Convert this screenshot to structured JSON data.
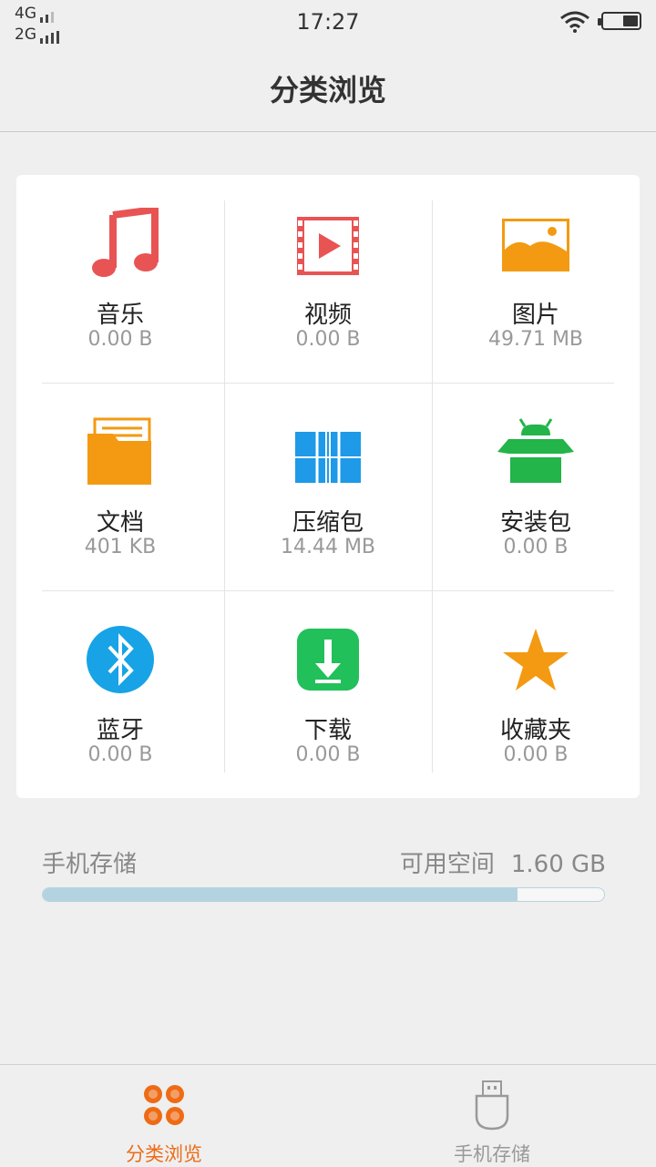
{
  "status_bar": {
    "network1": "4G",
    "network2": "2G",
    "time": "17:27"
  },
  "header": {
    "title": "分类浏览"
  },
  "categories": [
    {
      "name": "音乐",
      "size": "0.00 B",
      "icon": "music-note-icon",
      "color": "#e85454"
    },
    {
      "name": "视频",
      "size": "0.00 B",
      "icon": "film-play-icon",
      "color": "#e85454"
    },
    {
      "name": "图片",
      "size": "49.71 MB",
      "icon": "image-icon",
      "color": "#f39a12"
    },
    {
      "name": "文档",
      "size": "401 KB",
      "icon": "document-folder-icon",
      "color": "#f39a12"
    },
    {
      "name": "压缩包",
      "size": "14.44 MB",
      "icon": "archive-icon",
      "color": "#1e9ae8"
    },
    {
      "name": "安装包",
      "size": "0.00 B",
      "icon": "android-package-icon",
      "color": "#23b44a"
    },
    {
      "name": "蓝牙",
      "size": "0.00 B",
      "icon": "bluetooth-icon",
      "color": "#17a3e6"
    },
    {
      "name": "下载",
      "size": "0.00 B",
      "icon": "download-icon",
      "color": "#22c05a"
    },
    {
      "name": "收藏夹",
      "size": "0.00 B",
      "icon": "star-icon",
      "color": "#f39a12"
    }
  ],
  "storage": {
    "label": "手机存储",
    "free_label": "可用空间",
    "free_value": "1.60 GB",
    "used_fraction": 0.845
  },
  "bottom_nav": [
    {
      "label": "分类浏览",
      "icon": "category-grid-icon",
      "active": true,
      "color": "#ee6b16"
    },
    {
      "label": "手机存储",
      "icon": "usb-storage-icon",
      "active": false,
      "color": "#999999"
    }
  ]
}
